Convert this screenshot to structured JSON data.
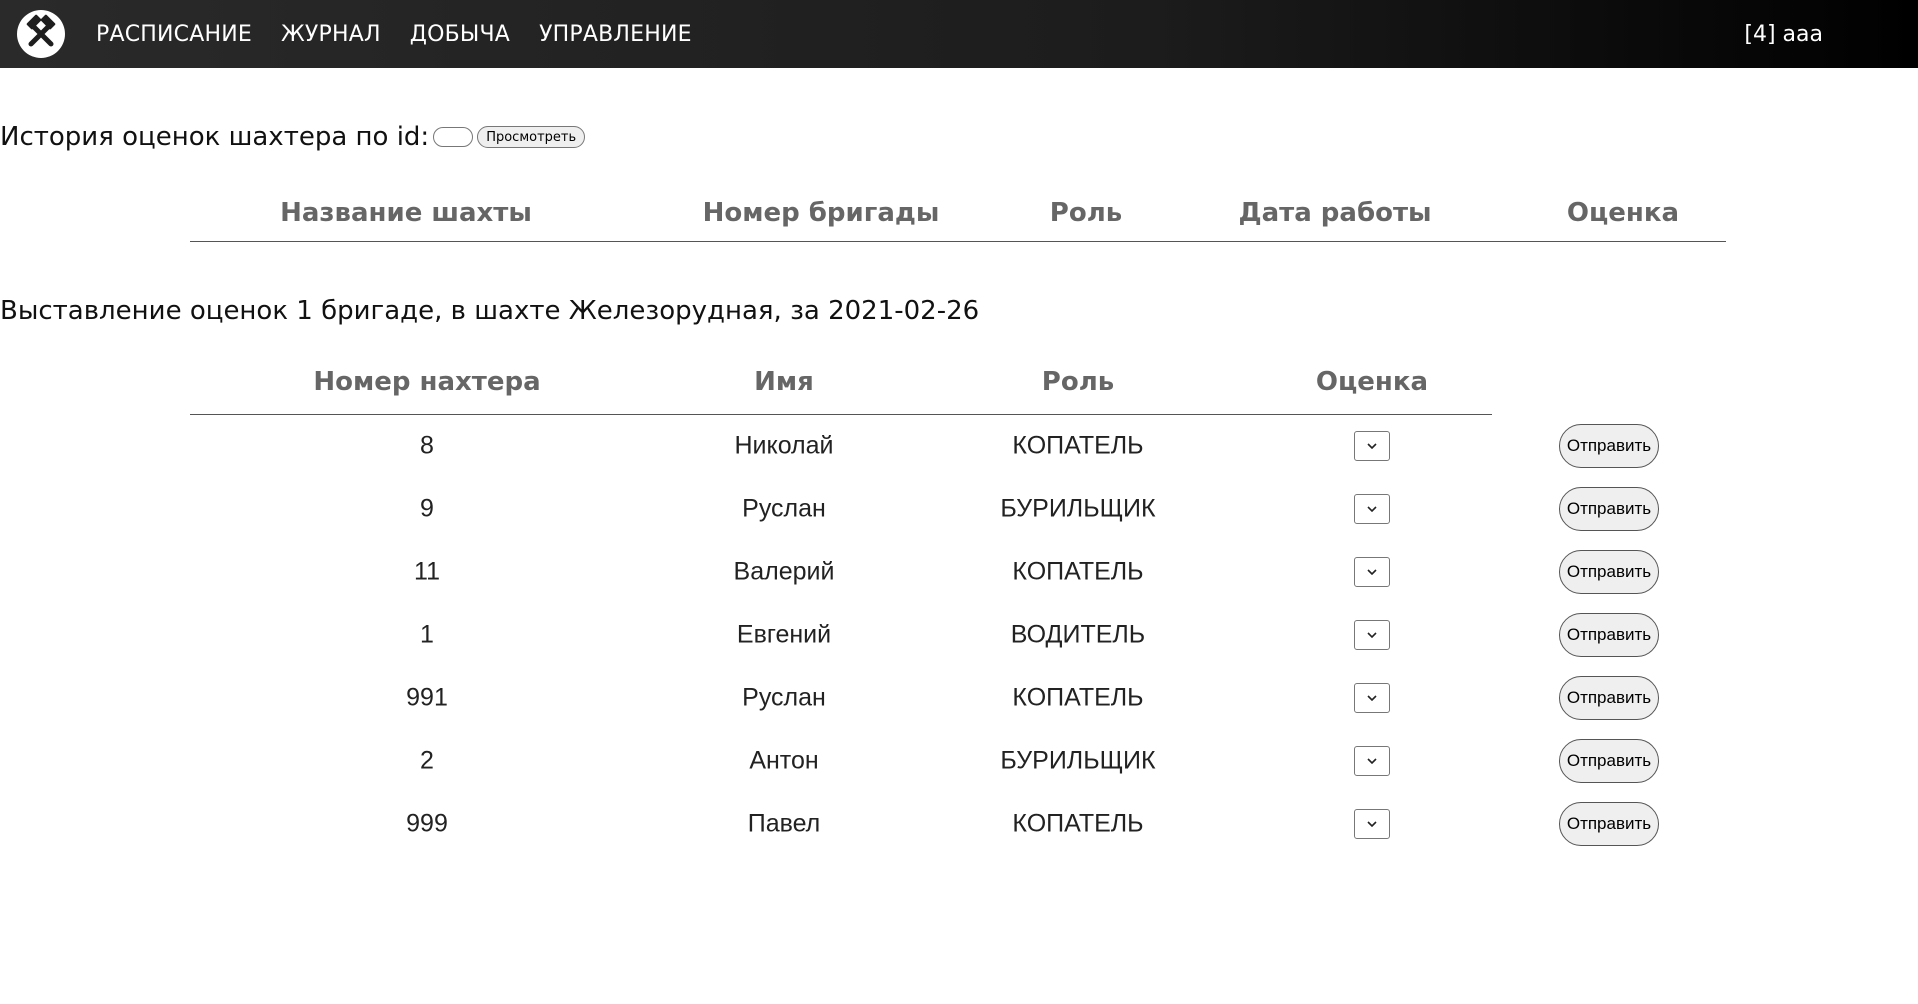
{
  "nav": {
    "logo_icon": "crossed-hammers-logo-icon",
    "items": [
      {
        "label": "РАСПИСАНИЕ"
      },
      {
        "label": "ЖУРНАЛ"
      },
      {
        "label": "ДОБЫЧА"
      },
      {
        "label": "УПРАВЛЕНИЕ"
      }
    ],
    "user": "[4] aaa"
  },
  "history": {
    "label": "История оценок шахтера по id:",
    "input_value": "",
    "view_button": "Просмотреть",
    "columns": [
      "Название шахты",
      "Номер бригады",
      "Роль",
      "Дата работы",
      "Оценка"
    ],
    "rows": []
  },
  "grading": {
    "title": "Выставление оценок 1 бригаде, в шахте Железорудная, за 2021-02-26",
    "columns": [
      "Номер нахтера",
      "Имя",
      "Роль",
      "Оценка"
    ],
    "send_label": "Отправить",
    "rows": [
      {
        "id": "8",
        "name": "Николай",
        "role": "КОПАТЕЛЬ",
        "grade": ""
      },
      {
        "id": "9",
        "name": "Руслан",
        "role": "БУРИЛЬЩИК",
        "grade": ""
      },
      {
        "id": "11",
        "name": "Валерий",
        "role": "КОПАТЕЛЬ",
        "grade": ""
      },
      {
        "id": "1",
        "name": "Евгений",
        "role": "ВОДИТЕЛЬ",
        "grade": ""
      },
      {
        "id": "991",
        "name": "Руслан",
        "role": "КОПАТЕЛЬ",
        "grade": ""
      },
      {
        "id": "2",
        "name": "Антон",
        "role": "БУРИЛЬЩИК",
        "grade": ""
      },
      {
        "id": "999",
        "name": "Павел",
        "role": "КОПАТЕЛЬ",
        "grade": ""
      }
    ]
  }
}
